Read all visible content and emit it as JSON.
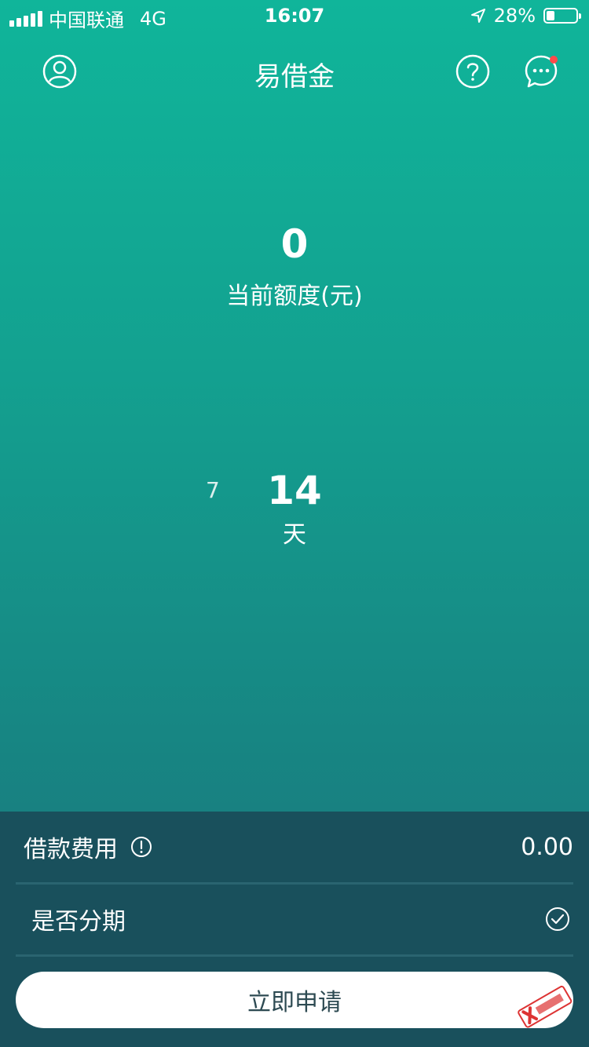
{
  "status_bar": {
    "carrier": "中国联通",
    "network": "4G",
    "time": "16:07",
    "battery_percent": "28%",
    "battery_level": 0.28
  },
  "header": {
    "title": "易借金"
  },
  "quota": {
    "value": "0",
    "label": "当前额度(元)"
  },
  "term": {
    "previous_option": "7",
    "selected": "14",
    "unit": "天"
  },
  "fee": {
    "label": "借款费用",
    "amount": "0.00"
  },
  "installment": {
    "label": "是否分期",
    "checked": true
  },
  "apply_button": {
    "label": "立即申请"
  },
  "colors": {
    "accent_top": "#10b59a",
    "accent_bottom": "#1a717b",
    "panel": "#19505c",
    "badge": "#ff4a4a"
  },
  "icons": [
    "signal-icon",
    "location-arrow-icon",
    "battery-icon",
    "profile-icon",
    "help-icon",
    "message-icon",
    "info-icon",
    "check-icon"
  ]
}
